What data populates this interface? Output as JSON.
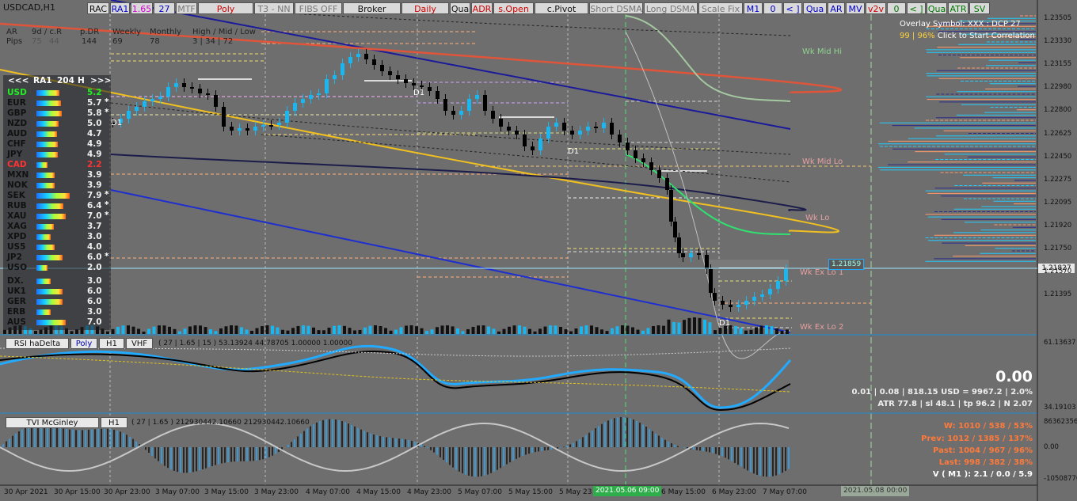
{
  "window": {
    "symbol": "USDCAD,H1"
  },
  "toolbar": {
    "buttons": [
      {
        "label": "RAC",
        "color": "#111"
      },
      {
        "label": "RA1",
        "color": "#0000cc"
      },
      {
        "label": "1.65",
        "color": "#cc00cc"
      },
      {
        "label": "27",
        "color": "#0000cc"
      },
      {
        "label": "MTF",
        "color": "#777"
      },
      {
        "label": "Poly",
        "color": "#cc0000"
      },
      {
        "label": "T3 - NN",
        "color": "#777"
      },
      {
        "label": "FIBS OFF",
        "color": "#777"
      },
      {
        "label": "Broker",
        "color": "#111"
      },
      {
        "label": "Daily",
        "color": "#cc0000"
      },
      {
        "label": "Qua",
        "color": "#111"
      },
      {
        "label": "ADR",
        "color": "#cc0000"
      },
      {
        "label": "s.Open",
        "color": "#cc0000"
      },
      {
        "label": "c.Pivot",
        "color": "#111"
      },
      {
        "label": "Short DSMA",
        "color": "#777"
      },
      {
        "label": "Long DSMA",
        "color": "#777"
      },
      {
        "label": "Scale Fix",
        "color": "#777"
      },
      {
        "label": "M1",
        "color": "#0000cc"
      },
      {
        "label": "0",
        "color": "#0000cc"
      },
      {
        "label": "< ]",
        "color": "#0000cc"
      },
      {
        "label": "Qua",
        "color": "#0000cc"
      },
      {
        "label": "AR",
        "color": "#0000cc"
      },
      {
        "label": "MV",
        "color": "#0000cc"
      },
      {
        "label": "v2v",
        "color": "#cc0000"
      },
      {
        "label": "0",
        "color": "#007700"
      },
      {
        "label": "< ]",
        "color": "#007700"
      },
      {
        "label": "Qua",
        "color": "#007700"
      },
      {
        "label": "ATR",
        "color": "#007700"
      },
      {
        "label": "SV",
        "color": "#007700"
      }
    ]
  },
  "stats": {
    "row1": [
      "AR",
      "9d / c.R",
      "p.DR",
      "Weekly",
      "Monthly",
      "High / Mid / Low"
    ],
    "row2_label": "Pips",
    "row2_9d": "75",
    "row2_cr": "44",
    "row2_pdr": "144",
    "row2_weekly": "69",
    "row2_monthly": "78",
    "row2_hml": "3  |  34  |  72"
  },
  "currency_panel": {
    "header": {
      "prev": "<<<",
      "label": "RA1",
      "value": "204",
      "tf": "H",
      "next": ">>>"
    },
    "items": [
      {
        "name": "USD",
        "value": "5.2",
        "star": "",
        "color": "#22ee22"
      },
      {
        "name": "EUR",
        "value": "5.7",
        "star": "*",
        "color": "#111"
      },
      {
        "name": "GBP",
        "value": "5.8",
        "star": "*",
        "color": "#111"
      },
      {
        "name": "NZD",
        "value": "5.0",
        "star": "",
        "color": "#111"
      },
      {
        "name": "AUD",
        "value": "4.7",
        "star": "",
        "color": "#111"
      },
      {
        "name": "CHF",
        "value": "4.9",
        "star": "",
        "color": "#111"
      },
      {
        "name": "JPY",
        "value": "4.9",
        "star": "",
        "color": "#111"
      },
      {
        "name": "CAD",
        "value": "2.2",
        "star": "",
        "color": "#ff3333"
      },
      {
        "name": "MXN",
        "value": "3.9",
        "star": "",
        "color": "#111"
      },
      {
        "name": "NOK",
        "value": "3.9",
        "star": "",
        "color": "#111"
      },
      {
        "name": "SEK",
        "value": "7.9",
        "star": "*",
        "color": "#111"
      },
      {
        "name": "RUB",
        "value": "6.4",
        "star": "*",
        "color": "#111"
      },
      {
        "name": "XAU",
        "value": "7.0",
        "star": "*",
        "color": "#111"
      },
      {
        "name": "XAG",
        "value": "3.7",
        "star": "",
        "color": "#111"
      },
      {
        "name": "XPD",
        "value": "3.0",
        "star": "",
        "color": "#111"
      },
      {
        "name": "US5",
        "value": "4.0",
        "star": "",
        "color": "#111"
      },
      {
        "name": "JP2",
        "value": "6.0",
        "star": "*",
        "color": "#111"
      },
      {
        "name": "USO",
        "value": "2.0",
        "star": "",
        "color": "#111"
      },
      {
        "name": "DX.",
        "value": "3.0",
        "star": "",
        "color": "#111"
      },
      {
        "name": "UK1",
        "value": "6.0",
        "star": "",
        "color": "#111"
      },
      {
        "name": "GER",
        "value": "6.0",
        "star": "",
        "color": "#111"
      },
      {
        "name": "ERB",
        "value": "3.0",
        "star": "",
        "color": "#111"
      },
      {
        "name": "AUS",
        "value": "7.0",
        "star": "",
        "color": "#111"
      }
    ]
  },
  "overlay": {
    "line1": "Overlay Symbol: XXX : DCP 27",
    "line2_pct": "99 | 96%",
    "line2_text": "Click to Start Correlation"
  },
  "levels": {
    "wk_mid_hi": "Wk Mid Hi",
    "wk_mid_lo": "Wk Mid Lo",
    "wk_lo": "Wk Lo",
    "wk_ex_lo_1": "Wk Ex Lo 1",
    "wk_ex_lo_2": "Wk Ex Lo 2",
    "d1": "D1"
  },
  "price_axis": {
    "ticks": [
      "1.23505",
      "1.23330",
      "1.23155",
      "1.22980",
      "1.22800",
      "1.22625",
      "1.22450",
      "1.22275",
      "1.22095",
      "1.21920",
      "1.21750",
      "1.21570",
      "1.21395"
    ],
    "marker_price": "1.21859",
    "current_price": "1.21827"
  },
  "rsi_pane": {
    "title": "RSI haDelta",
    "mode": "Poly",
    "tf": "H1",
    "tag": "VHF",
    "params": "( 27 | 1.65 | 15 ) 53.13924 44.78705 1.00000 1.00000",
    "axis_top": "61.13637",
    "axis_bottom": "34.19103",
    "big_value": "0.00",
    "line1": "0.01  |  0.08  |  818.15 USD = 9967.2  |  2.0%",
    "line2": "ATR 77.8  | sl 48.1  |  tp 96.2  |  N 2.07"
  },
  "tvi_pane": {
    "title": "TVI McGinley",
    "tf": "H1",
    "params": "( 27 | 1.65 ) 212930442.10660 212930442.10660",
    "axis_top": "86362356",
    "axis_mid": "0.00",
    "axis_bottom": "-10508770",
    "w": "W: 1010 / 538 / 53%",
    "prev": "Prev: 1012 / 1385 / 137%",
    "past": "Past: 1004 / 967 / 96%",
    "last": "Last: 998 / 382 / 38%",
    "v": "V ( M1 ): 2.1 / 0.0 / 5.9"
  },
  "time_axis": {
    "labels": [
      "30 Apr 2021",
      "30 Apr 15:00",
      "30 Apr 23:00",
      "3 May 07:00",
      "3 May 15:00",
      "3 May 23:00",
      "4 May 07:00",
      "4 May 15:00",
      "4 May 23:00",
      "5 May 07:00",
      "5 May 15:00",
      "5 May 23"
    ],
    "labels2": [
      "6 May 15:00",
      "6 May 23:00",
      "7 May 07:00"
    ],
    "highlight1": "2021.05.06 09:00",
    "highlight2": "2021.05.08 00:00"
  },
  "colors": {
    "background": "#6e6e6e",
    "bull": "#1ab6f0",
    "bear": "#000000",
    "upper_channel": "#1a1a9a",
    "ma_red": "#e0553a",
    "ma_yellow": "#f0c020",
    "ma_green": "#30e070",
    "accent_blue": "#22aaff"
  }
}
